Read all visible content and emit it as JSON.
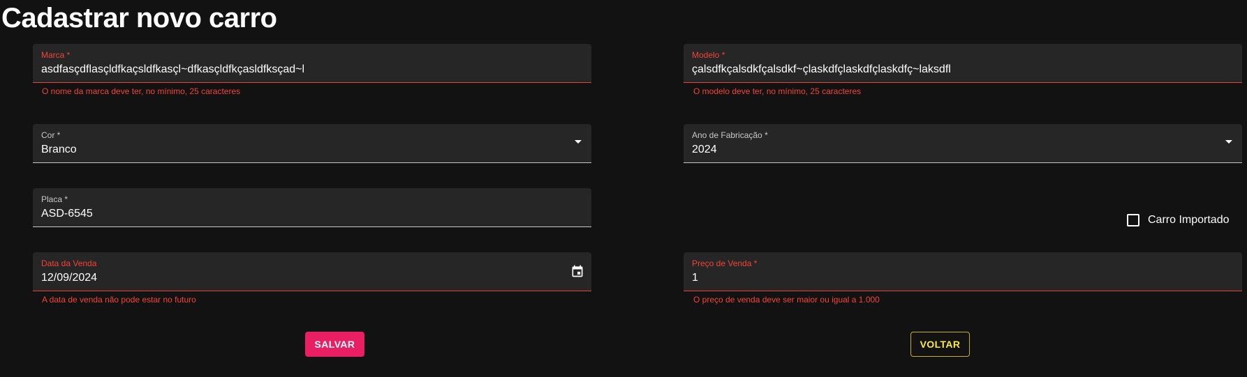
{
  "page": {
    "title": "Cadastrar novo carro"
  },
  "form": {
    "marca": {
      "label": "Marca *",
      "value": "asdfasçdflasçldfkaçsldfkasçl~dfkasçldfkçasldfksçad~l",
      "error": "O nome da marca deve ter, no mínimo, 25 caracteres"
    },
    "modelo": {
      "label": "Modelo *",
      "value": "çalsdfkçalsdkfçalsdkf~çlaskdfçlaskdfçlaskdfç~laksdfl",
      "error": "O modelo deve ter, no mínimo, 25 caracteres"
    },
    "cor": {
      "label": "Cor *",
      "value": "Branco"
    },
    "ano": {
      "label": "Ano de Fabricação *",
      "value": "2024"
    },
    "placa": {
      "label": "Placa *",
      "value": "ASD-6545"
    },
    "importado": {
      "label": "Carro Importado",
      "checked": false
    },
    "data_venda": {
      "label": "Data da Venda",
      "value": "12/09/2024",
      "error": "A data de venda não pode estar no futuro"
    },
    "preco_venda": {
      "label": "Preço de Venda *",
      "value": "1",
      "error": "O preço de venda deve ser maior ou igual a 1.000"
    }
  },
  "buttons": {
    "save_label": "SALVAR",
    "back_label": "VOLTAR"
  },
  "icons": {
    "select_caret": "arrow-drop-down-icon",
    "date_picker": "calendar-icon",
    "checkbox": "checkbox-unchecked-icon"
  },
  "colors": {
    "background": "#121212",
    "field_bg": "#262626",
    "error": "#f44336",
    "primary": "#e91e63",
    "accent": "#ffeb3b"
  }
}
